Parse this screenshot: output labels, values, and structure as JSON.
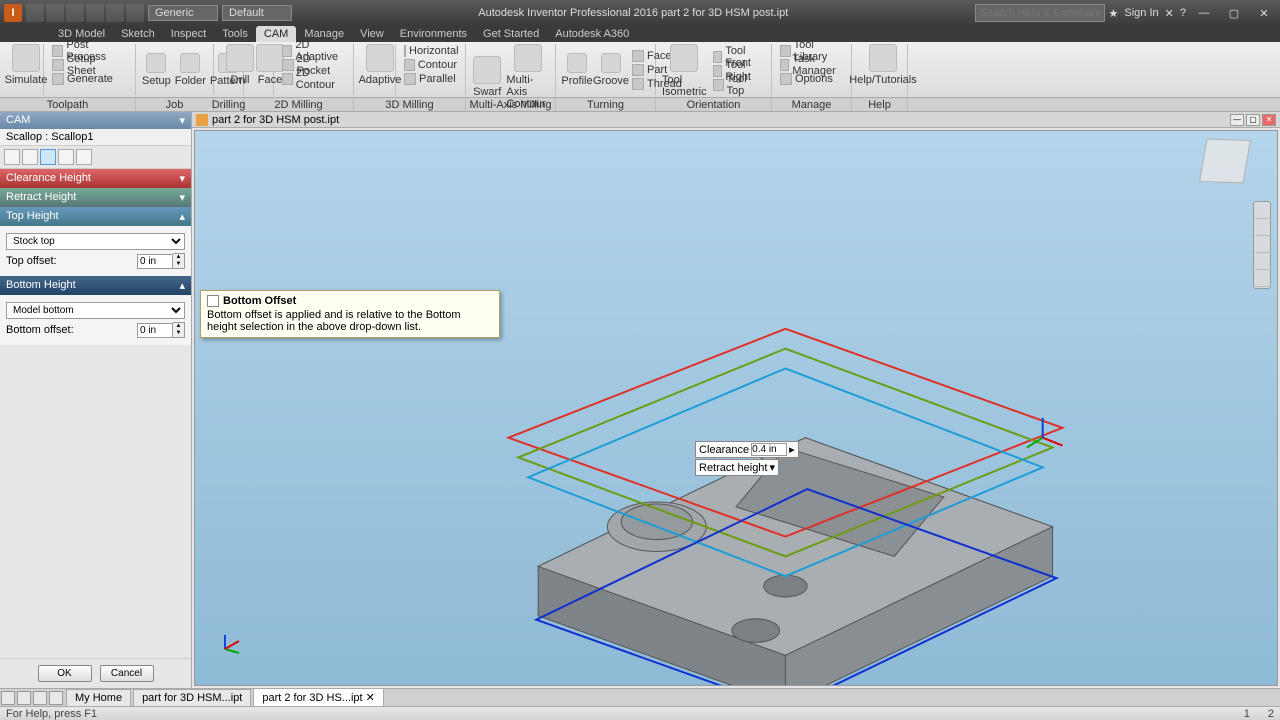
{
  "titlebar": {
    "title": "Autodesk Inventor Professional 2016   part 2 for 3D HSM post.ipt",
    "dd1": "Generic",
    "dd2": "Default",
    "search_placeholder": "Search Help & Commands...",
    "signin": "Sign In"
  },
  "menutabs": [
    "3D Model",
    "Sketch",
    "Inspect",
    "Tools",
    "CAM",
    "Manage",
    "View",
    "Environments",
    "Get Started",
    "Autodesk A360"
  ],
  "menutabs_active": 4,
  "ribbon": {
    "setup": {
      "btn": "Setup",
      "items": [
        "Post Process",
        "Setup Sheet",
        "Generate"
      ]
    },
    "job": {
      "btns": [
        "Setup",
        "Folder",
        "Pattern"
      ],
      "panel": "Job"
    },
    "drill": "Drill",
    "face": "Face",
    "milling2d": {
      "items": [
        "2D Adaptive",
        "2D Pocket",
        "2D Contour"
      ],
      "panel": "2D Milling"
    },
    "adaptive": "Adaptive",
    "milling3d": {
      "items": [
        "Horizontal",
        "Contour",
        "Parallel"
      ],
      "panel": "3D Milling"
    },
    "multi": {
      "btns": [
        "Swarf",
        "Multi-Axis Contour"
      ],
      "panel": "Multi-Axis Milling"
    },
    "turning": {
      "btns": [
        "Profile",
        "Groove"
      ],
      "face": "Face",
      "part": "Part",
      "thread": "Thread",
      "panel": "Turning"
    },
    "orient": {
      "btn": "Tool Isometric",
      "items": [
        "Tool Front",
        "Tool Right",
        "Tool Top"
      ],
      "panel": "Orientation"
    },
    "manage": {
      "items": [
        "Tool Library",
        "Task Manager",
        "Options"
      ],
      "panel": "Manage"
    },
    "help": {
      "btn": "Help/Tutorials",
      "panel": "Help"
    },
    "toolpath": "Toolpath",
    "drilling": "Drilling"
  },
  "left": {
    "cam": "CAM",
    "node": "Scallop : Scallop1",
    "clearance": "Clearance Height",
    "retract": "Retract Height",
    "top": "Top Height",
    "top_from": "Stock top",
    "top_offset_lbl": "Top offset:",
    "top_offset_val": "0 in",
    "bottom": "Bottom Height",
    "bottom_from": "Model bottom",
    "bottom_offset_lbl": "Bottom offset:",
    "bottom_offset_val": "0 in",
    "ok": "OK",
    "cancel": "Cancel"
  },
  "tooltip": {
    "title": "Bottom Offset",
    "body": "Bottom offset is applied and is relative to the Bottom height selection in the above drop-down list."
  },
  "doc": {
    "tabname": "part 2 for 3D HSM post.ipt"
  },
  "canvas": {
    "clearance_lbl": "Clearance",
    "clearance_val": "0.4 in",
    "retract_lbl": "Retract height"
  },
  "doctabs": {
    "home": "My Home",
    "t1": "part for 3D HSM...ipt",
    "t2": "part 2 for 3D HS...ipt"
  },
  "status": {
    "left": "For Help, press F1",
    "n1": "1",
    "n2": "2"
  }
}
